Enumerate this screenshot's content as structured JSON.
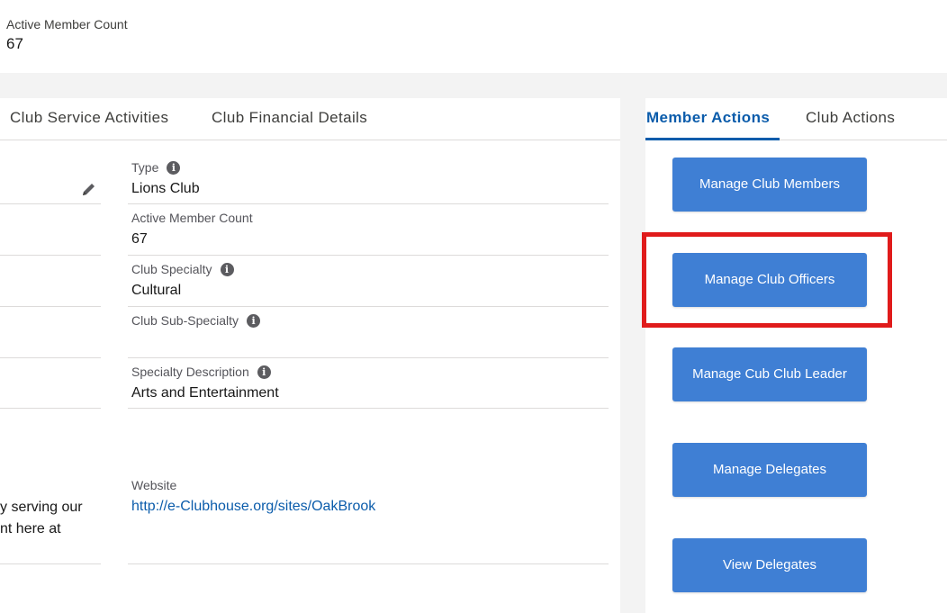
{
  "top_summary": {
    "active_member_count_label": "Active Member Count",
    "active_member_count_value": "67"
  },
  "main_tabs": [
    {
      "label": "Club Service Activities"
    },
    {
      "label": "Club Financial Details"
    }
  ],
  "fields": {
    "type": {
      "label": "Type",
      "value": "Lions Club"
    },
    "active_member_count": {
      "label": "Active Member Count",
      "value": "67"
    },
    "club_specialty": {
      "label": "Club Specialty",
      "value": "Cultural"
    },
    "club_sub_specialty": {
      "label": "Club Sub-Specialty",
      "value": ""
    },
    "specialty_description": {
      "label": "Specialty Description",
      "value": "Arts and Entertainment"
    },
    "website": {
      "label": "Website",
      "value": "http://e-Clubhouse.org/sites/OakBrook"
    }
  },
  "left_partial_text": {
    "line1": "y serving our",
    "line2": "nt here at"
  },
  "side_tabs": [
    {
      "label": "Member Actions",
      "active": true
    },
    {
      "label": "Club Actions",
      "active": false
    }
  ],
  "actions": [
    {
      "label": "Manage Club Members"
    },
    {
      "label": "Manage Club Officers"
    },
    {
      "label": "Manage Cub Club Leader"
    },
    {
      "label": "Manage Delegates"
    },
    {
      "label": "View Delegates"
    }
  ],
  "icons": {
    "info": "info-circle-icon",
    "edit": "pencil-icon"
  },
  "colors": {
    "accent_blue": "#0b5cab",
    "button_blue": "#3f7fd4",
    "highlight_red": "#e01b1b"
  }
}
